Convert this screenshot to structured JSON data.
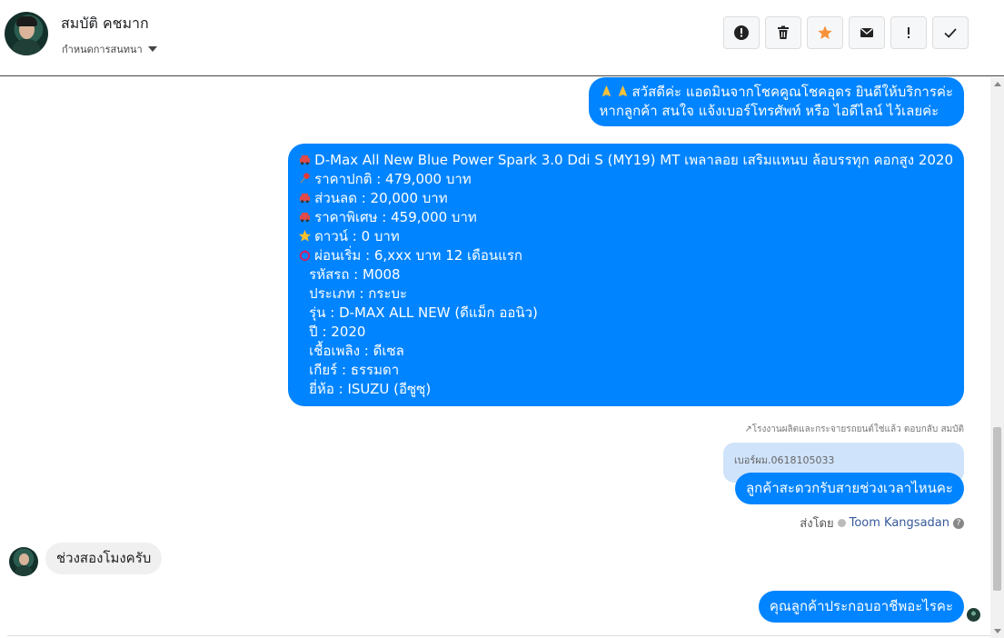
{
  "header": {
    "name": "สมบัติ คชมาก",
    "subtitle": "กำหนดการสนทนา",
    "actions": [
      "report",
      "delete",
      "star",
      "mail",
      "important",
      "done"
    ]
  },
  "messages": {
    "greeting_line1": "สวัสดีค่ะ แอดมินจากโชคคูณโชคอุดร ยินดีให้บริการค่ะ",
    "greeting_line2": "หากลูกค้า สนใจ แจ้งเบอร์โทรศัพท์ หรือ ไอดีไลน์  ไว้เลยค่ะ",
    "car": {
      "title": "D-Max All New Blue Power Spark 3.0 Ddi S (MY19) MT เพลาลอย เสริมแหนบ ล้อบรรทุก คอกสูง 2020",
      "price_normal": "ราคาปกติ : 479,000 บาท",
      "discount": "ส่วนลด : 20,000 บาท",
      "price_special": "ราคาพิเศษ : 459,000 บาท",
      "down": "ดาวน์ : 0 บาท",
      "installment": "ผ่อนเริ่ม : 6,xxx บาท 12 เดือนแรก",
      "code": "รหัสรถ : M008",
      "type": "ประเภท : กระบะ",
      "model": "รุ่น : D-MAX ALL NEW (ดีแม็ก ออนิว)",
      "year": "ปี : 2020",
      "fuel": "เชื้อเพลิง : ดีเซล",
      "gear": "เกียร์ : ธรรมดา",
      "brand": "ยี่ห้อ : ISUZU (อีซูซุ)"
    },
    "reply_label": "โรงงานผลิตและกระจายรถยนต์ใช่แล้ว ตอบกลับ สมบัติ",
    "quoted_text": "เบอร์ผม.0618105033",
    "ask_time": "ลูกค้าสะดวกรับสายช่วงเวลาไหนคะ",
    "sent_by_prefix": "ส่งโดย",
    "agent_name": "Toom Kangsadan",
    "incoming_reply": "ช่วงสองโมงครับ",
    "ask_job": "คุณลูกค้าประกอบอาชีพอะไรคะ"
  },
  "colors": {
    "bubble_out": "#0084ff",
    "bubble_in": "#f1f0f0",
    "quoted": "#cfe3fb",
    "star": "#f7923a"
  }
}
